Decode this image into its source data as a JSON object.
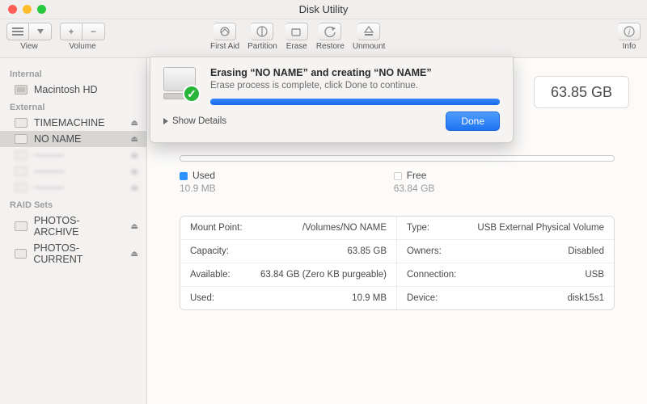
{
  "window": {
    "title": "Disk Utility"
  },
  "toolbar": {
    "view": "View",
    "volume": "Volume",
    "first_aid": "First Aid",
    "partition": "Partition",
    "erase": "Erase",
    "restore": "Restore",
    "unmount": "Unmount",
    "info": "Info",
    "plus": "+",
    "minus": "−"
  },
  "sidebar": {
    "internal_header": "Internal",
    "internal_items": [
      "Macintosh HD"
    ],
    "external_header": "External",
    "external_items": [
      "TIMEMACHINE",
      "NO NAME"
    ],
    "external_selected": "NO NAME",
    "raid_header": "RAID Sets",
    "raid_items": [
      "PHOTOS-ARCHIVE",
      "PHOTOS-CURRENT"
    ]
  },
  "capacity_box": "63.85 GB",
  "usage": {
    "used_label": "Used",
    "used_value": "10.9 MB",
    "free_label": "Free",
    "free_value": "63.84 GB"
  },
  "details": {
    "left": [
      {
        "k": "Mount Point:",
        "v": "/Volumes/NO NAME"
      },
      {
        "k": "Capacity:",
        "v": "63.85 GB"
      },
      {
        "k": "Available:",
        "v": "63.84 GB (Zero KB purgeable)"
      },
      {
        "k": "Used:",
        "v": "10.9 MB"
      }
    ],
    "right": [
      {
        "k": "Type:",
        "v": "USB External Physical Volume"
      },
      {
        "k": "Owners:",
        "v": "Disabled"
      },
      {
        "k": "Connection:",
        "v": "USB"
      },
      {
        "k": "Device:",
        "v": "disk15s1"
      }
    ]
  },
  "sheet": {
    "title": "Erasing “NO NAME” and creating “NO NAME”",
    "subtitle": "Erase process is complete, click Done to continue.",
    "show_details": "Show Details",
    "done": "Done"
  }
}
